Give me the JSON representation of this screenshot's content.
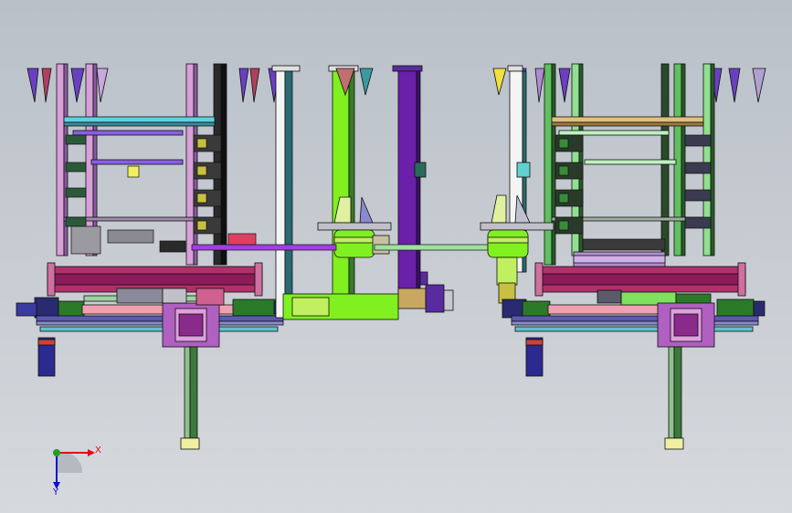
{
  "viewport": {
    "background_top": "#b9c0c8",
    "background_bottom": "#d6d9dd"
  },
  "triad": {
    "x_label": "X",
    "y_label": "Y",
    "x_color": "#e01010",
    "y_color": "#1010d0",
    "origin_color": "#20a020"
  },
  "palette": {
    "pink": "#d8a0d8",
    "magenta": "#b0306a",
    "dark_magenta": "#8a1c5a",
    "green": "#80f020",
    "dark_green": "#3a7a2a",
    "purple": "#6a20a8",
    "cyan": "#60d0e0",
    "navy": "#20206a",
    "teal": "#2a6a70",
    "olive": "#8a8a20",
    "salmon": "#f0a0a0",
    "white": "#f4f4f4",
    "black": "#101010",
    "yellow": "#f0f080"
  }
}
